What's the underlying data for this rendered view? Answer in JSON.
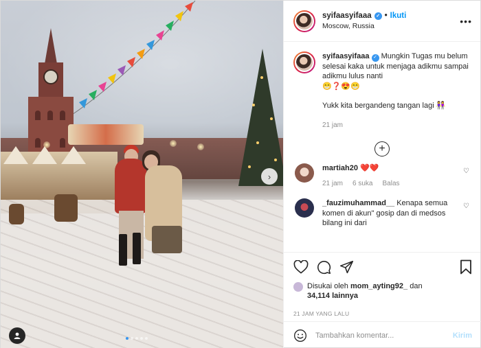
{
  "post": {
    "username": "syifaasyifaaa",
    "follow_label": "Ikuti",
    "location": "Moscow, Russia",
    "more_label": "•••"
  },
  "caption": {
    "username": "syifaasyifaaa",
    "text": "Mungkin Tugas mu belum selesai kaka untuk menjaga adikmu sampai adikmu lulus nanti",
    "emojis": "😁❓😍😁",
    "second_line": "Yukk kita bergandeng tangan lagi 👭",
    "time": "21 jam"
  },
  "load_more_label": "+",
  "comments": [
    {
      "username": "martiah20",
      "text": "❤️❤️",
      "time": "21 jam",
      "likes": "6 suka",
      "reply": "Balas"
    },
    {
      "username": "_fauzimuhammad__",
      "text": "Kenapa semua komen di akun\" gosip dan di medsos bilang ini dari"
    }
  ],
  "likes": {
    "prefix": "Disukai oleh",
    "user": "mom_ayting92_",
    "suffix": "dan",
    "count": "34,114 lainnya"
  },
  "timestamp": "21 JAM YANG LALU",
  "add_comment": {
    "placeholder": "Tambahkan komentar...",
    "post_label": "Kirim"
  },
  "colors": {
    "link_blue": "#0095f6",
    "verified_blue": "#3897f0",
    "heart_red": "#ed4956",
    "post_disabled": "#b2dffc",
    "meta_grey": "#8e8e8e"
  },
  "icons": {
    "like": "heart-outline-icon",
    "comment": "speech-bubble-icon",
    "share": "paper-plane-icon",
    "save": "bookmark-icon",
    "emoji": "smiley-icon",
    "next": "chevron-right-icon",
    "tag": "user-tag-icon"
  }
}
